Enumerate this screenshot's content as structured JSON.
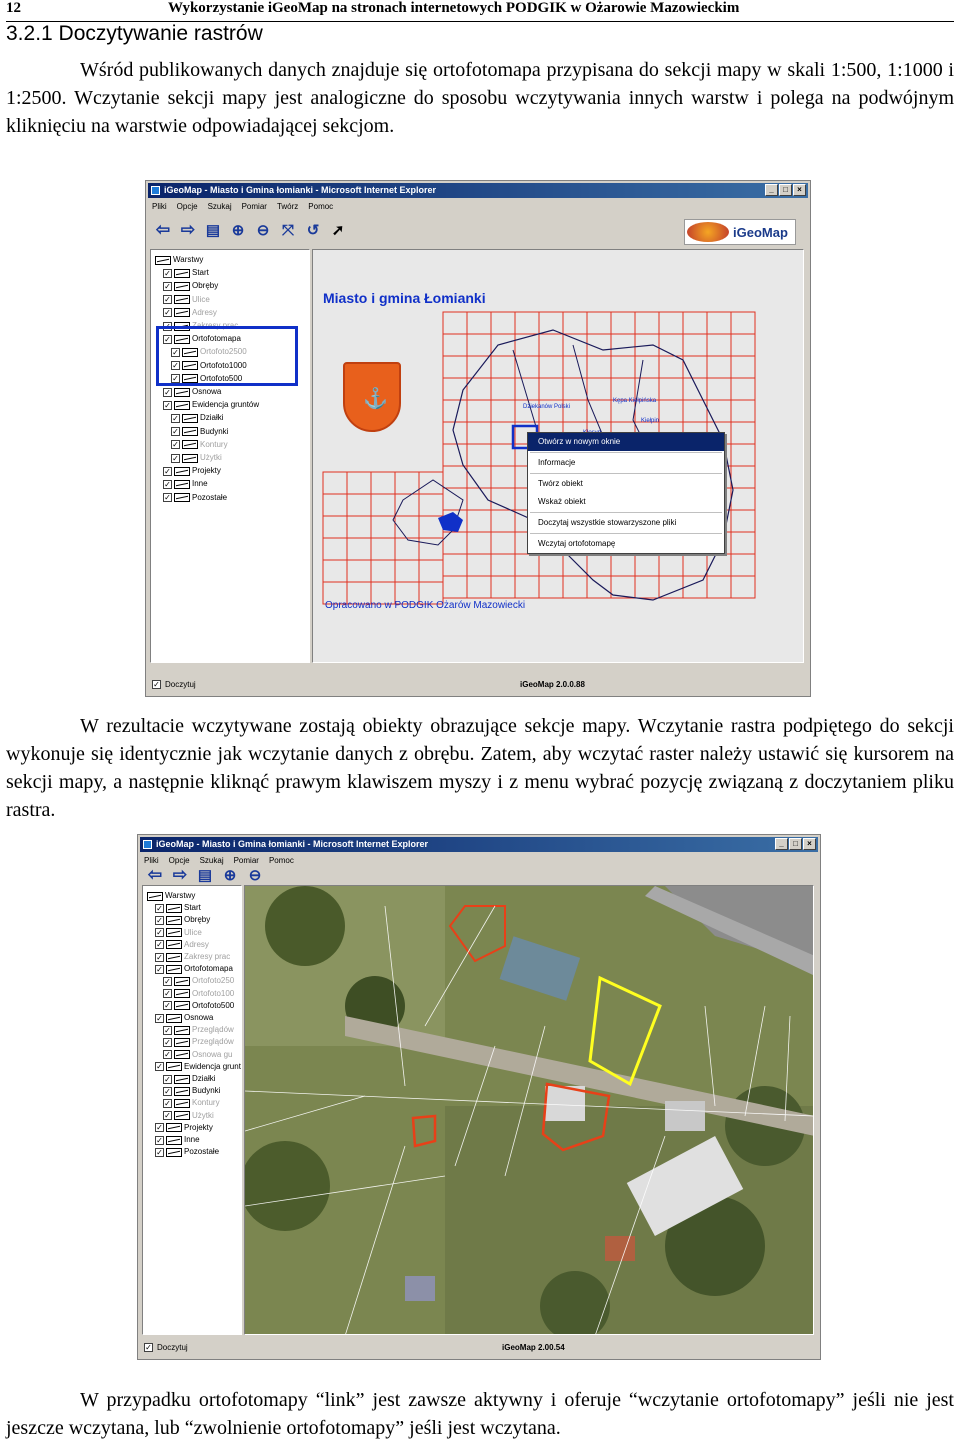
{
  "header": {
    "page_number": "12",
    "running_title": "Wykorzystanie iGeoMap na stronach internetowych PODGIK w Ożarowie Mazowieckim"
  },
  "section": {
    "title": "3.2.1 Doczytywanie rastrów"
  },
  "paragraphs": [
    "Wśród publikowanych danych znajduje się ortofotomapa przypisana do sekcji mapy w skali 1:500, 1:1000 i 1:2500. Wczytanie sekcji mapy jest analogiczne do sposobu wczytywania innych warstw i polega na podwójnym kliknięciu na warstwie odpowiadającej sekcjom.",
    "W rezultacie wczytywane zostają obiekty obrazujące sekcje mapy. Wczytanie rastra podpiętego do sekcji wykonuje się identycznie jak wczytanie danych z obrębu. Zatem, aby wczytać raster należy ustawić się kursorem na sekcji mapy, a następnie kliknąć prawym klawiszem myszy i z menu wybrać pozycję związaną z doczytaniem pliku rastra.",
    "W przypadku ortofotomapy “link” jest zawsze aktywny i oferuje “wczytanie ortofotomapy” jeśli nie jest jeszcze wczytana, lub “zwolnienie ortofotomapy” jeśli jest wczytana."
  ],
  "screenshot1": {
    "window_title": "iGeoMap - Miasto i Gmina łomianki - Microsoft Internet Explorer",
    "menu": [
      "Pliki",
      "Opcje",
      "Szukaj",
      "Pomiar",
      "Twórz",
      "Pomoc"
    ],
    "logo_text": "iGeoMap",
    "tree": [
      {
        "label": "Warstwy",
        "level": 0,
        "dim": false,
        "checkbox": false
      },
      {
        "label": "Start",
        "level": 1,
        "dim": false,
        "checkbox": true
      },
      {
        "label": "Obręby",
        "level": 1,
        "dim": false,
        "checkbox": true
      },
      {
        "label": "Ulice",
        "level": 1,
        "dim": true,
        "checkbox": true
      },
      {
        "label": "Adresy",
        "level": 1,
        "dim": true,
        "checkbox": true
      },
      {
        "label": "Zakresy prac",
        "level": 1,
        "dim": true,
        "checkbox": true
      },
      {
        "label": "Ortofotomapa",
        "level": 1,
        "dim": false,
        "checkbox": true
      },
      {
        "label": "Ortofoto2500",
        "level": 2,
        "dim": true,
        "checkbox": true
      },
      {
        "label": "Ortofoto1000",
        "level": 2,
        "dim": false,
        "checkbox": true
      },
      {
        "label": "Ortofoto500",
        "level": 2,
        "dim": false,
        "checkbox": true
      },
      {
        "label": "Osnowa",
        "level": 1,
        "dim": false,
        "checkbox": true
      },
      {
        "label": "Ewidencja gruntów",
        "level": 1,
        "dim": false,
        "checkbox": true
      },
      {
        "label": "Działki",
        "level": 2,
        "dim": false,
        "checkbox": true
      },
      {
        "label": "Budynki",
        "level": 2,
        "dim": false,
        "checkbox": true
      },
      {
        "label": "Kontury",
        "level": 2,
        "dim": true,
        "checkbox": true
      },
      {
        "label": "Użytki",
        "level": 2,
        "dim": true,
        "checkbox": true
      },
      {
        "label": "Projekty",
        "level": 1,
        "dim": false,
        "checkbox": true
      },
      {
        "label": "Inne",
        "level": 1,
        "dim": false,
        "checkbox": true
      },
      {
        "label": "Pozostałe",
        "level": 1,
        "dim": false,
        "checkbox": true
      }
    ],
    "map_title": "Miasto i gmina Łomianki",
    "map_footer": "Opracowano w PODGIK Ożarów Mazowiecki",
    "place_labels": [
      "Kępa Kiełpińska",
      "Dziekanów Polski",
      "Kiełpin",
      "Kłosyn"
    ],
    "context_menu": [
      "Otwórz w nowym oknie",
      "Informacje",
      "Twórz obiekt",
      "Wskaż obiekt",
      "Doczytaj wszystkie stowarzyszone pliki",
      "Wczytaj ortofotomapę"
    ],
    "status_checkbox": "Doczytuj",
    "version": "iGeoMap 2.0.0.88"
  },
  "screenshot2": {
    "window_title": "iGeoMap - Miasto i Gmina łomianki - Microsoft Internet Explorer",
    "menu": [
      "Pliki",
      "Opcje",
      "Szukaj",
      "Pomiar",
      "Pomoc"
    ],
    "tree": [
      {
        "label": "Warstwy",
        "level": 0,
        "dim": false
      },
      {
        "label": "Start",
        "level": 1,
        "dim": false
      },
      {
        "label": "Obręby",
        "level": 1,
        "dim": false
      },
      {
        "label": "Ulice",
        "level": 1,
        "dim": true
      },
      {
        "label": "Adresy",
        "level": 1,
        "dim": true
      },
      {
        "label": "Zakresy prac",
        "level": 1,
        "dim": true
      },
      {
        "label": "Ortofotomapa",
        "level": 1,
        "dim": false
      },
      {
        "label": "Ortofoto250",
        "level": 2,
        "dim": true
      },
      {
        "label": "Ortofoto100",
        "level": 2,
        "dim": true
      },
      {
        "label": "Ortofoto500",
        "level": 2,
        "dim": false
      },
      {
        "label": "Osnowa",
        "level": 1,
        "dim": false
      },
      {
        "label": "Przeglądów",
        "level": 2,
        "dim": true
      },
      {
        "label": "Przeglądów",
        "level": 2,
        "dim": true
      },
      {
        "label": "Osnowa gu",
        "level": 2,
        "dim": true
      },
      {
        "label": "Ewidencja grunt",
        "level": 1,
        "dim": false
      },
      {
        "label": "Działki",
        "level": 2,
        "dim": false
      },
      {
        "label": "Budynki",
        "level": 2,
        "dim": false
      },
      {
        "label": "Kontury",
        "level": 2,
        "dim": true
      },
      {
        "label": "Użytki",
        "level": 2,
        "dim": true
      },
      {
        "label": "Projekty",
        "level": 1,
        "dim": false
      },
      {
        "label": "Inne",
        "level": 1,
        "dim": false
      },
      {
        "label": "Pozostałe",
        "level": 1,
        "dim": false
      }
    ],
    "status_checkbox": "Doczytuj",
    "version": "iGeoMap 2.00.54"
  }
}
